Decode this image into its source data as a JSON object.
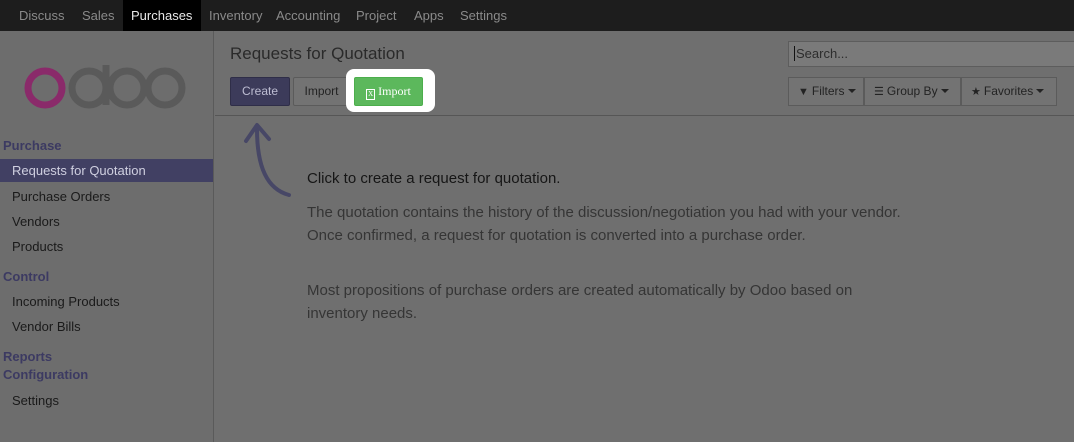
{
  "top_menu": [
    "Discuss",
    "Sales",
    "Purchases",
    "Inventory",
    "Accounting",
    "Project",
    "Apps",
    "Settings"
  ],
  "active_menu": "Purchases",
  "logo_text": "odoo",
  "sidebar": {
    "sections": [
      {
        "title": "Purchase",
        "items": [
          "Requests for Quotation",
          "Purchase Orders",
          "Vendors",
          "Products"
        ]
      },
      {
        "title": "Control",
        "items": [
          "Incoming Products",
          "Vendor Bills"
        ]
      },
      {
        "title": "Reports",
        "items": []
      },
      {
        "title": "Configuration",
        "items": [
          "Settings"
        ]
      }
    ],
    "active_item": "Requests for Quotation"
  },
  "page_title": "Requests for Quotation",
  "buttons": {
    "create": "Create",
    "import": "Import",
    "import_highlighted": "Import"
  },
  "search": {
    "placeholder": "Search..."
  },
  "search_options": {
    "filters": "Filters",
    "group_by": "Group By",
    "favorites": "Favorites"
  },
  "help": {
    "title": "Click to create a request for quotation.",
    "paragraph1": "The quotation contains the history of the discussion/negotiation you had with your vendor. Once confirmed, a request for quotation is converted into a purchase order.",
    "paragraph2": "Most propositions of purchase orders are created automatically by Odoo based on inventory needs."
  },
  "colors": {
    "primary": "#414063",
    "highlight_button": "#5cb85c",
    "logo_o": "#8a2a6a",
    "logo_doo": "#5a5a5a"
  },
  "icons": [
    "filter-icon",
    "list-icon",
    "star-icon",
    "file-excel-icon",
    "arrow-icon"
  ]
}
